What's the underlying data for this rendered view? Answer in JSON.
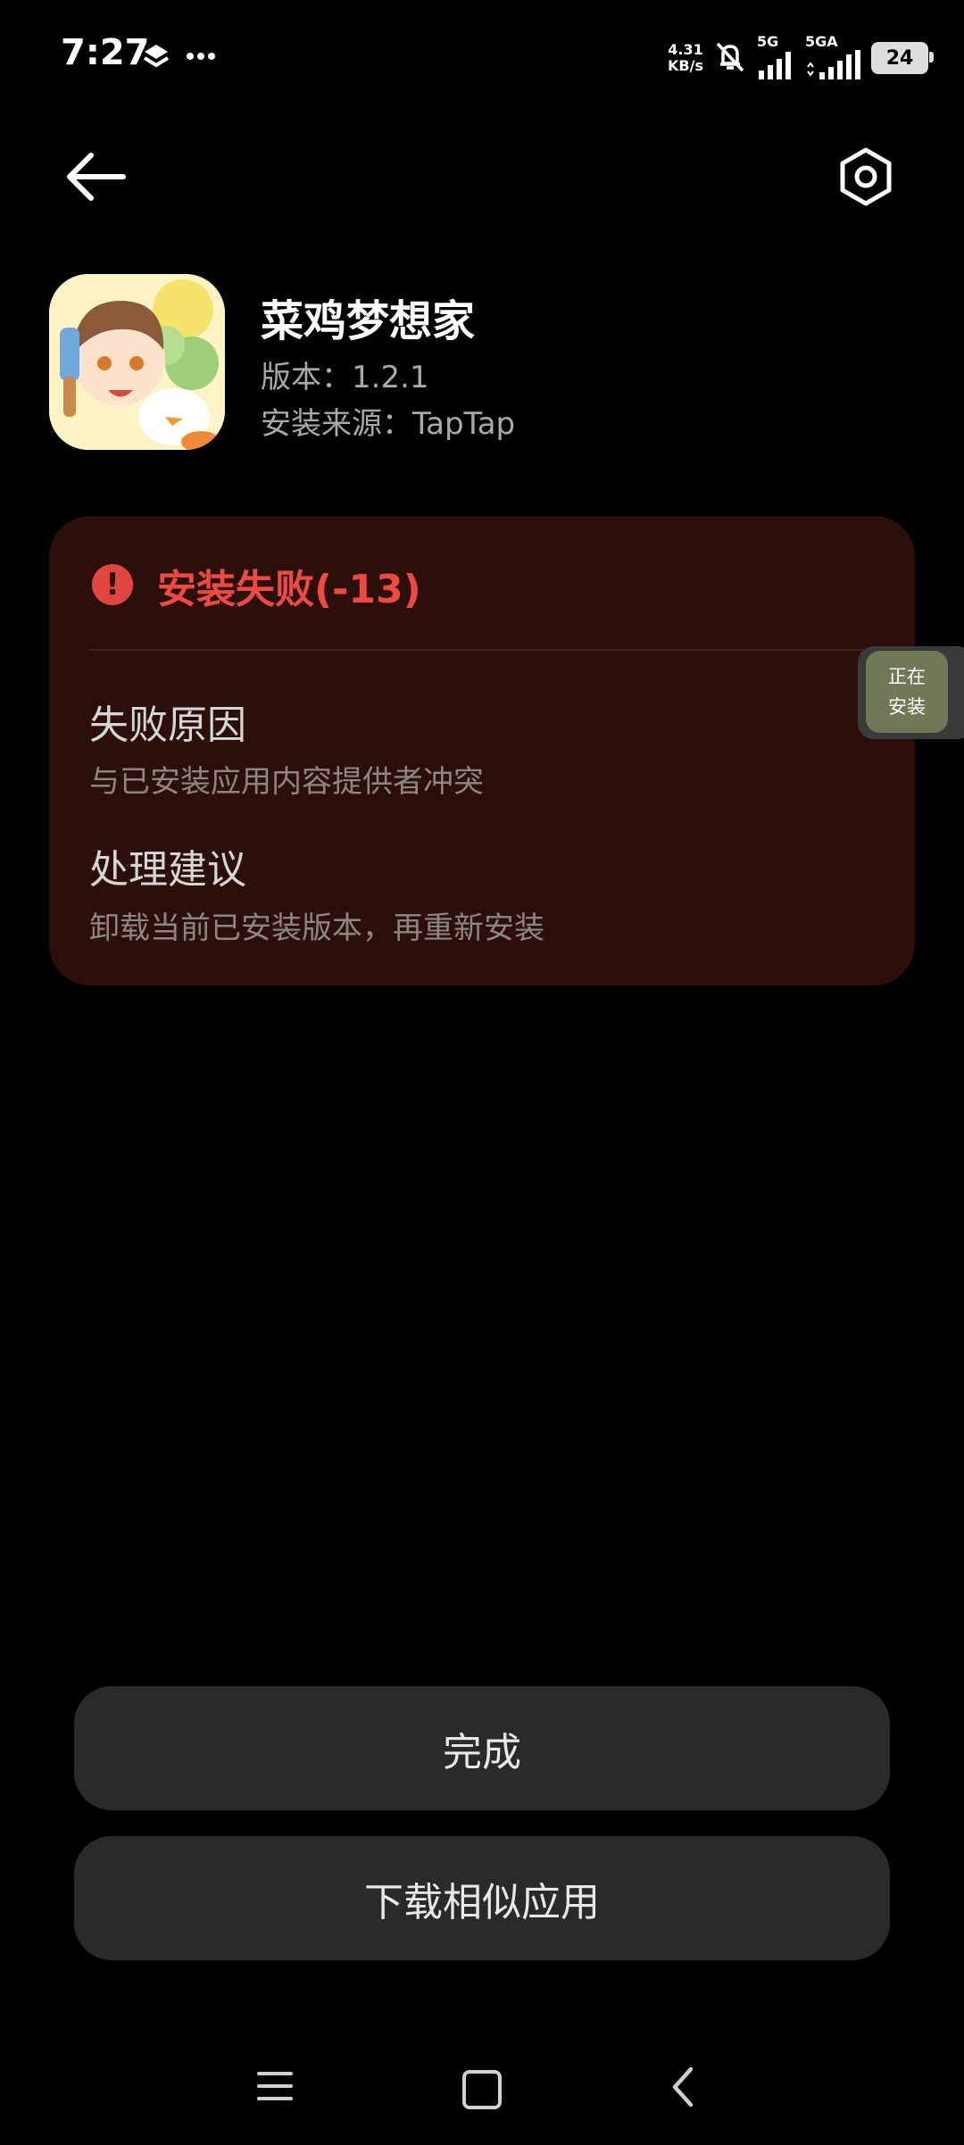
{
  "status_bar": {
    "time": "7:27",
    "net_speed_value": "4.31",
    "net_speed_unit": "KB/s",
    "sim1_label": "5G",
    "sim2_label": "5GA",
    "battery": "24"
  },
  "app": {
    "name": "菜鸡梦想家",
    "version": "版本：1.2.1",
    "source": "安装来源：TapTap"
  },
  "error": {
    "title": "安装失败(-13)",
    "reason_heading": "失败原因",
    "reason_text": "与已安装应用内容提供者冲突",
    "suggestion_heading": "处理建议",
    "suggestion_text": "卸载当前已安装版本，再重新安装"
  },
  "floating": {
    "line1": "正在",
    "line2": "安装"
  },
  "buttons": {
    "done": "完成",
    "download_similar": "下载相似应用"
  },
  "colors": {
    "background": "#000000",
    "card": "#2c0f0a",
    "error_red": "#ef4a42",
    "button": "#2a2a2a"
  }
}
